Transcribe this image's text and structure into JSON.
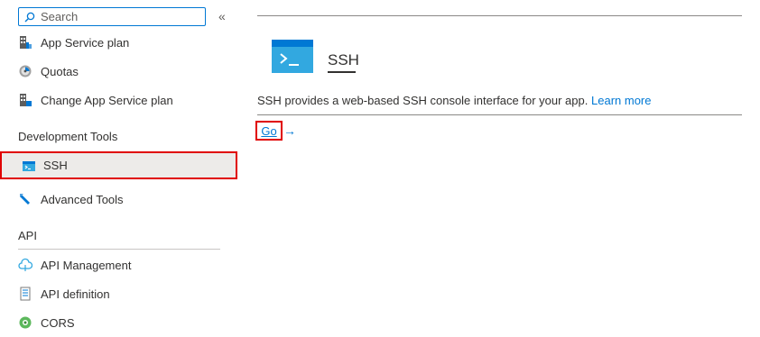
{
  "search": {
    "placeholder": "Search"
  },
  "sidebar": {
    "collapse_glyph": "«",
    "items_top": [
      {
        "label": "App Service plan",
        "icon": "app-service-plan-icon"
      },
      {
        "label": "Quotas",
        "icon": "quotas-icon"
      },
      {
        "label": "Change App Service plan",
        "icon": "change-plan-icon"
      }
    ],
    "sections": [
      {
        "title": "Development Tools",
        "items": [
          {
            "label": "SSH",
            "icon": "ssh-icon",
            "selected": true
          },
          {
            "label": "Advanced Tools",
            "icon": "advanced-tools-icon"
          }
        ]
      },
      {
        "title": "API",
        "items": [
          {
            "label": "API Management",
            "icon": "api-management-icon"
          },
          {
            "label": "API definition",
            "icon": "api-definition-icon"
          },
          {
            "label": "CORS",
            "icon": "cors-icon"
          }
        ]
      }
    ]
  },
  "main": {
    "title": "SSH",
    "description": "SSH provides a web-based SSH console interface for your app.",
    "learn_more": "Learn more",
    "go_label": "Go",
    "go_arrow": "→"
  },
  "colors": {
    "accent": "#0078d4",
    "highlight_border": "#e00000",
    "selected_bg": "#edebe9"
  }
}
